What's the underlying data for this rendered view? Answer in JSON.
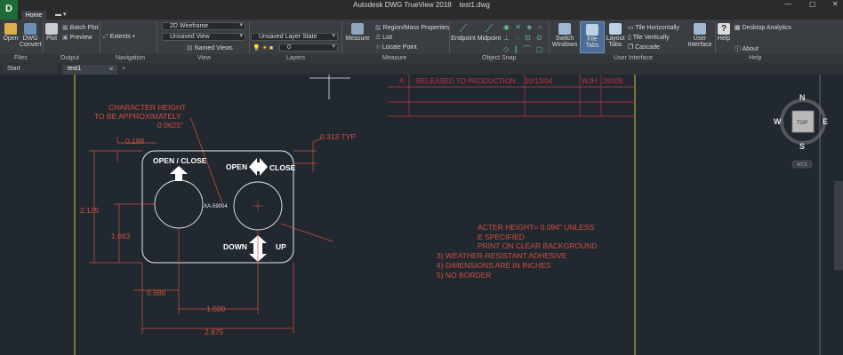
{
  "app": {
    "title": "Autodesk DWG TrueView 2018",
    "file": "test1.dwg",
    "logo": "D"
  },
  "ribbon_tabs": {
    "home": "Home"
  },
  "files": {
    "open": "Open",
    "dwg_convert_1": "DWG",
    "dwg_convert_2": "Convert",
    "panel": "Files"
  },
  "output": {
    "plot": "Plot",
    "batch_plot": "Batch Plot",
    "preview": "Preview",
    "panel": "Output"
  },
  "navigation": {
    "extents": "Extents",
    "panel": "Navigation"
  },
  "view": {
    "visual_style": "2D Wireframe",
    "saved_view": "Unsaved View",
    "named_views": "Named Views",
    "panel": "View"
  },
  "layers": {
    "layer_state": "Unsaved Layer State",
    "layer_value": "0",
    "panel": "Layers"
  },
  "measure": {
    "measure": "Measure",
    "region_mass": "Region/Mass Properties",
    "list": "List",
    "locate_point": "Locate Point",
    "panel": "Measure"
  },
  "object_snap": {
    "endpoint": "Endpoint",
    "midpoint": "Midpoint",
    "panel": "Object Snap"
  },
  "user_interface": {
    "switch_windows_1": "Switch",
    "switch_windows_2": "Windows",
    "file_tabs": "File Tabs",
    "layout_tabs_1": "Layout",
    "layout_tabs_2": "Tabs",
    "tile_h": "Tile Horizontally",
    "tile_v": "Tile Vertically",
    "cascade": "Cascade",
    "user_interface_1": "User",
    "user_interface_2": "Interface",
    "panel": "User Interface"
  },
  "help": {
    "help": "Help",
    "desktop_analytics": "Desktop Analytics",
    "about": "About",
    "panel": "Help"
  },
  "doc_tabs": {
    "start": "Start",
    "test1": "test1"
  },
  "viewcube": {
    "n": "N",
    "s": "S",
    "e": "E",
    "w": "W",
    "top": "TOP",
    "wcs": "WCS"
  },
  "drawing": {
    "revision": {
      "letter": "A",
      "description": "RELEASED TO PRODUCTION",
      "date": "10/13/04",
      "initials": "WJH",
      "number": "29109"
    },
    "note_char_height": [
      "CHARACTER HEIGHT",
      "TO BE APPROXIMATELY",
      "0.0625\""
    ],
    "dim_0188": "0.188",
    "dim_0313": "0.313 TYP",
    "dim_2125": "2.125",
    "dim_1063": "1.063",
    "dim_0688": "0.688",
    "dim_1500": "1.500",
    "dim_2875": "2.875",
    "label_open_close": "OPEN / CLOSE",
    "label_open": "OPEN",
    "label_close": "CLOSE",
    "label_down": "DOWN",
    "label_up": "UP",
    "part_number": "XA-59004",
    "notes": [
      "ACTER HEIGHT= 0.094\" UNLESS",
      "E  SPECIFIED",
      "PRINT ON CLEAR BACKGROUND",
      "3)  WEATHER-RESISTANT ADHESIVE",
      "4)  DIMENSIONS ARE IN INCHES",
      "5)  NO BORDER"
    ]
  },
  "colors": {
    "dim_red": "#d2503c",
    "border_yellow": "#c8c832",
    "canvas_bg": "#212830",
    "outline_white": "#ececec",
    "accent_blue": "#4a8fd6"
  }
}
